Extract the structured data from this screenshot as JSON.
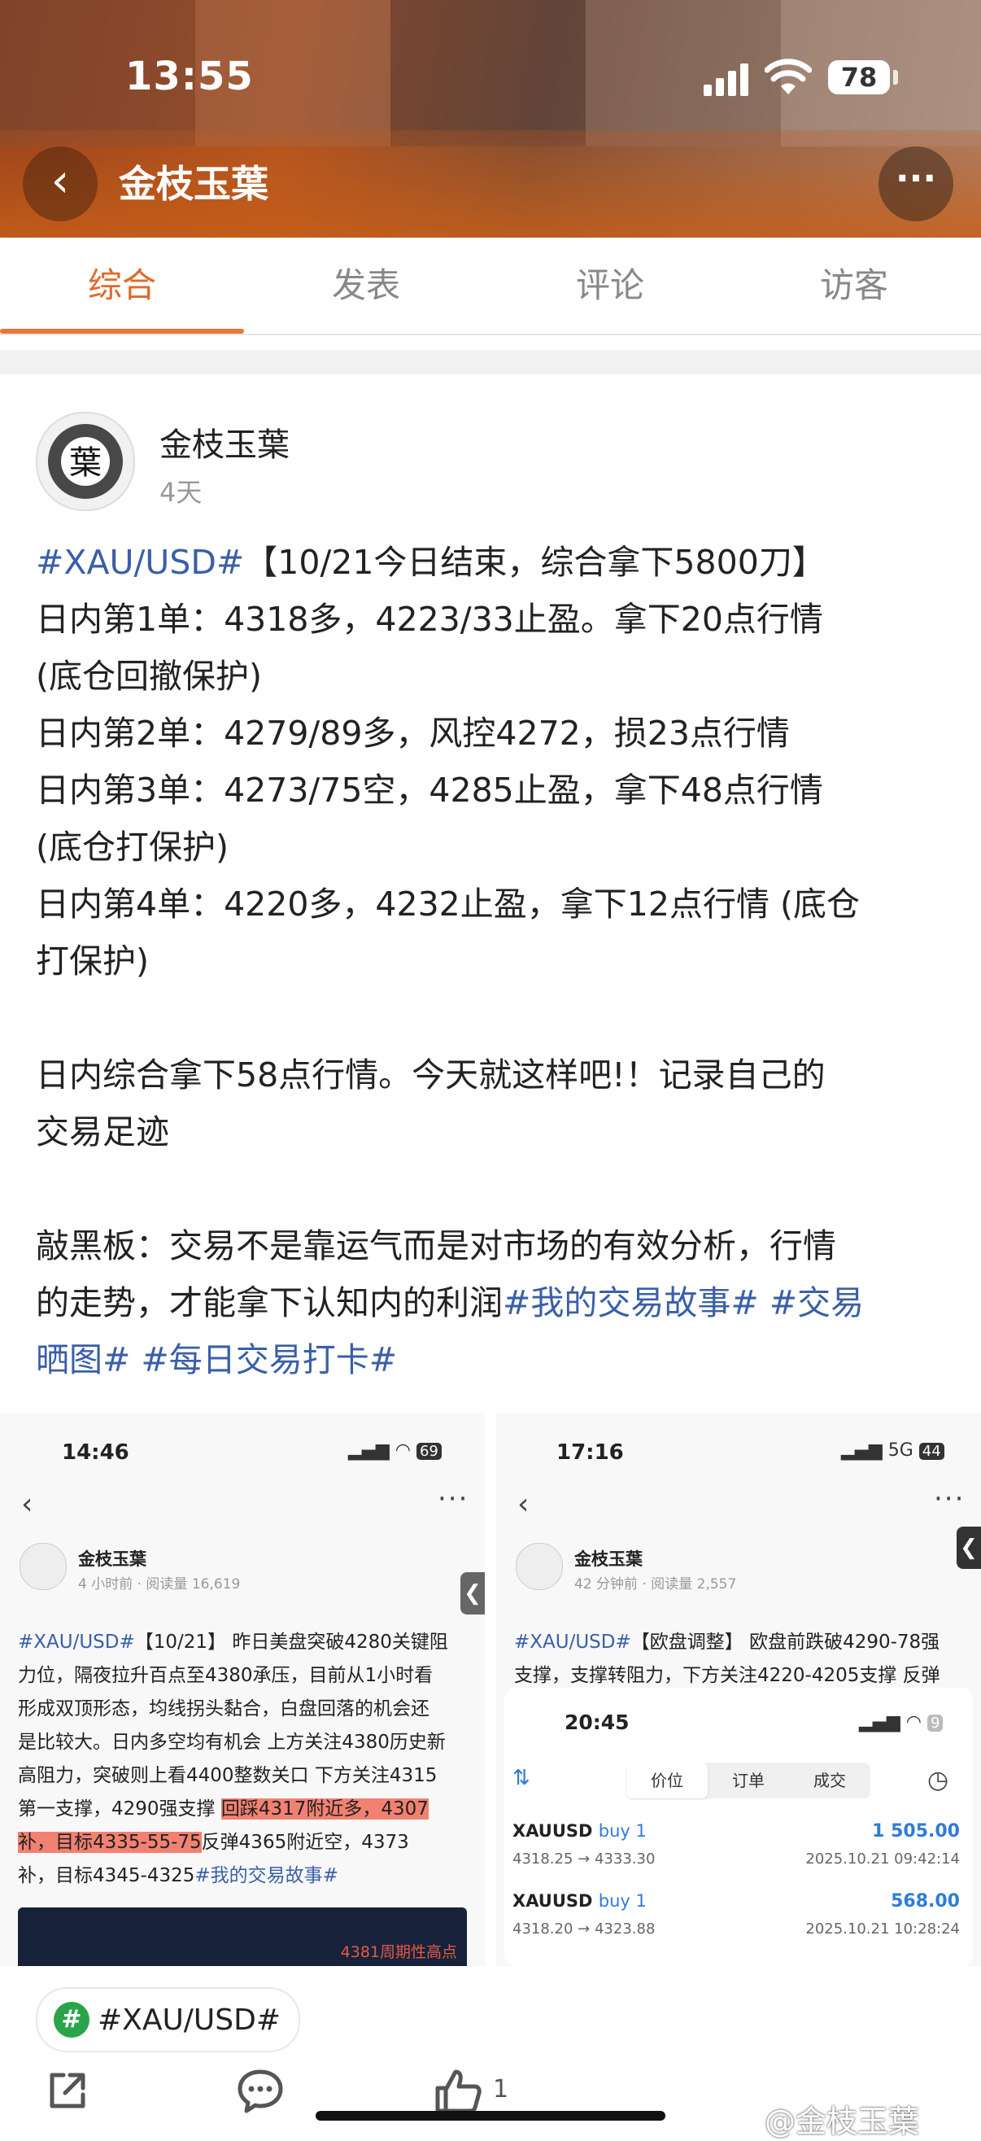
{
  "status_bar": {
    "time": "13:55",
    "battery": "78"
  },
  "header": {
    "title": "金枝玉葉"
  },
  "tabs": [
    "综合",
    "发表",
    "评论",
    "访客"
  ],
  "post": {
    "author": "金枝玉葉",
    "time": "4天",
    "lines": {
      "l1_tag": "#XAU/USD#",
      "l1_text": "【10/21今日结束，综合拿下5800刀】",
      "l2": "日内第1单：4318多，4223/33止盈。拿下20点行情",
      "l3": "(底仓回撤保护)",
      "l4": "日内第2单：4279/89多，风控4272，损23点行情",
      "l5": "日内第3单：4273/75空，4285止盈，拿下48点行情",
      "l6": "(底仓打保护)",
      "l7": "日内第4单：4220多，4232止盈，拿下12点行情 (底仓",
      "l8": "打保护)",
      "l9": "日内综合拿下58点行情。今天就这样吧!！记录自己的",
      "l10": "交易足迹",
      "l11_text": "敲黑板：交易不是靠运气而是对市场的有效分析，行情",
      "l12_text": "的走势，才能拿下认知内的利润",
      "l12_tag1": "#我的交易故事#",
      "l12_tag2": "#交易",
      "l13_tag2b": "晒图#",
      "l13_tag3": "#每日交易打卡#"
    }
  },
  "shot_left": {
    "time": "14:46",
    "battery": "69",
    "author": "金枝玉葉",
    "meta": "4 小时前 · 阅读量 16,619",
    "t1_tag": "#XAU/USD#",
    "t1": "【10/21】 昨日美盘突破4280关键阻",
    "t2": "力位，隔夜拉升百点至4380承压，目前从1小时看",
    "t3": "形成双顶形态，均线拐头黏合，白盘回落的机会还",
    "t4": "是比较大。日内多空均有机会 上方关注4380历史新",
    "t5": "高阻力，突破则上看4400整数关口 下方关注4315",
    "t6a": "第一支撑，4290强支撑 ",
    "t6b": "回踩4317附近多，4307",
    "t7a": "补，目标4335-55-75",
    "t7b": "反弹4365附近空，4373",
    "t8a": "补，目标4345-4325",
    "t8_tag": "#我的交易故事#",
    "chart_label": "4381周期性高点"
  },
  "shot_right": {
    "time": "17:16",
    "network": "5G",
    "battery": "44",
    "author": "金枝玉葉",
    "meta": "42 分钟前 · 阅读量 2,557",
    "t1_tag": "#XAU/USD#",
    "t1": "【欧盘调整】 欧盘前跌破4290-78强",
    "t2": "支撑，支撑转阻力，下方关注4220-4205支撑 反弹",
    "inner": {
      "time": "20:45",
      "battery": "9",
      "segments": [
        "价位",
        "订单",
        "成交"
      ],
      "trades": [
        {
          "symbol": "XAUUSD",
          "direction": "buy 1",
          "pnl": "1 505.00",
          "range": "4318.25 → 4333.30",
          "ts": "2025.10.21 09:42:14"
        },
        {
          "symbol": "XAUUSD",
          "direction": "buy 1",
          "pnl": "568.00",
          "range": "4318.20 → 4323.88",
          "ts": "2025.10.21 10:28:24"
        }
      ]
    }
  },
  "topic": {
    "label": "#XAU/USD#",
    "icon": "#"
  },
  "actions": {
    "like_count": "1"
  },
  "watermark": "@金枝玉葉"
}
